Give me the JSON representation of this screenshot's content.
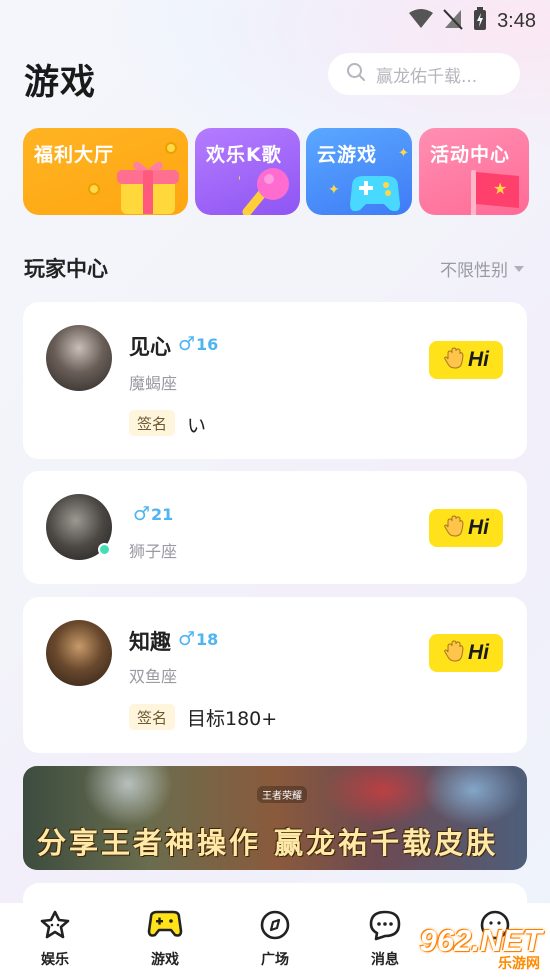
{
  "status_bar": {
    "time": "3:48"
  },
  "header": {
    "title": "游戏",
    "search_placeholder": "赢龙佑千载..."
  },
  "features": [
    {
      "label": "福利大厅",
      "icon": "gift-icon"
    },
    {
      "label": "欢乐K歌",
      "icon": "microphone-icon"
    },
    {
      "label": "云游戏",
      "icon": "gamepad-icon"
    },
    {
      "label": "活动中心",
      "icon": "flag-icon"
    }
  ],
  "section": {
    "title": "玩家中心",
    "filter": "不限性别"
  },
  "users": [
    {
      "name": "见心",
      "age": "16",
      "zodiac": "魔蝎座",
      "sig_label": "签名",
      "signature": "い",
      "online": false
    },
    {
      "name": "",
      "age": "21",
      "zodiac": "狮子座",
      "online": true
    },
    {
      "name": "知趣",
      "age": "18",
      "zodiac": "双鱼座",
      "sig_label": "签名",
      "signature": "目标180+",
      "online": false
    }
  ],
  "hi_label": "Hi",
  "banner": {
    "text": "分享王者神操作 赢龙祐千载皮肤",
    "brand": "王者荣耀"
  },
  "nav": [
    {
      "label": "娱乐",
      "icon": "star-icon",
      "active": false
    },
    {
      "label": "游戏",
      "icon": "gamepad-icon",
      "active": true
    },
    {
      "label": "广场",
      "icon": "compass-icon",
      "active": false
    },
    {
      "label": "消息",
      "icon": "chat-icon",
      "active": false
    },
    {
      "label": "",
      "icon": "profile-icon",
      "active": false
    }
  ],
  "watermark": {
    "main": "962.NET",
    "sub": "乐游网"
  },
  "colors": {
    "accent_yellow": "#ffe21a",
    "gender_blue": "#4fb4f2",
    "online_green": "#3fe0b4"
  }
}
